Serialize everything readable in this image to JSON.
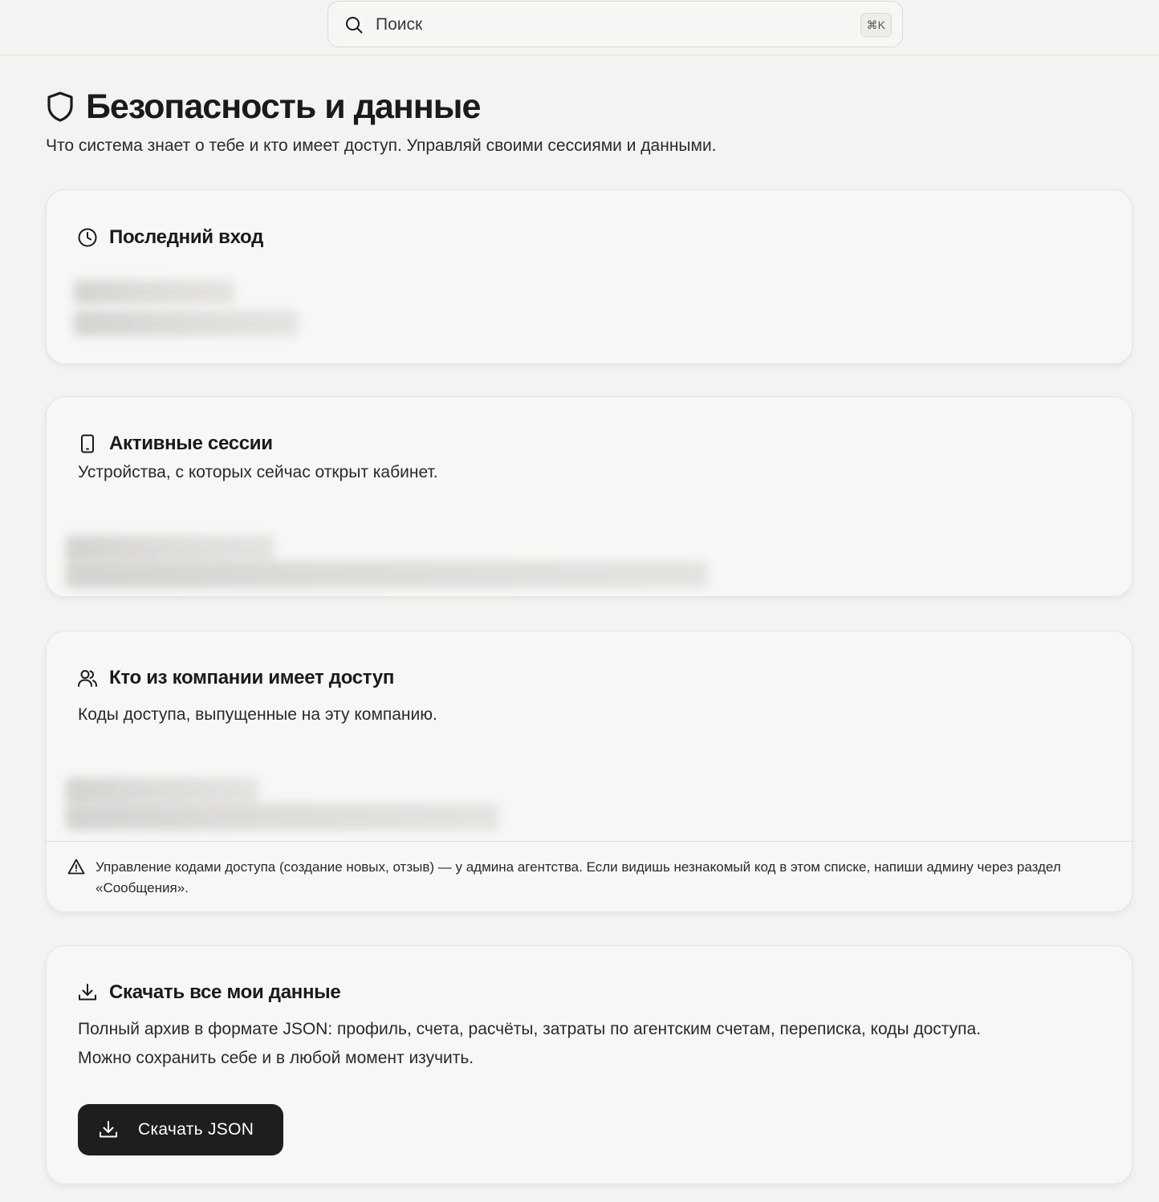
{
  "search": {
    "placeholder": "Поиск",
    "shortcut": "⌘K"
  },
  "page": {
    "title": "Безопасность и данные",
    "subtitle": "Что система знает о тебе и кто имеет доступ. Управляй своими сессиями и данными."
  },
  "cards": {
    "last_login": {
      "title": "Последний вход",
      "icon": "clock-icon"
    },
    "sessions": {
      "title": "Активные сессии",
      "icon": "phone-icon",
      "description": "Устройства, с которых сейчас открыт кабинет."
    },
    "access": {
      "title": "Кто из компании имеет доступ",
      "icon": "users-icon",
      "description": "Коды доступа, выпущенные на эту компанию.",
      "note": "Управление кодами доступа (создание новых, отзыв) — у админа агентства. Если видишь незнакомый код в этом списке, напиши админу через раздел «Сообщения»."
    },
    "download": {
      "title": "Скачать все мои данные",
      "icon": "download-icon",
      "description_line1": "Полный архив в формате JSON: профиль, счета, расчёты, затраты по агентским счетам, переписка, коды доступа.",
      "description_line2": "Можно сохранить себе и в любой момент изучить.",
      "button_label": "Скачать JSON"
    }
  }
}
